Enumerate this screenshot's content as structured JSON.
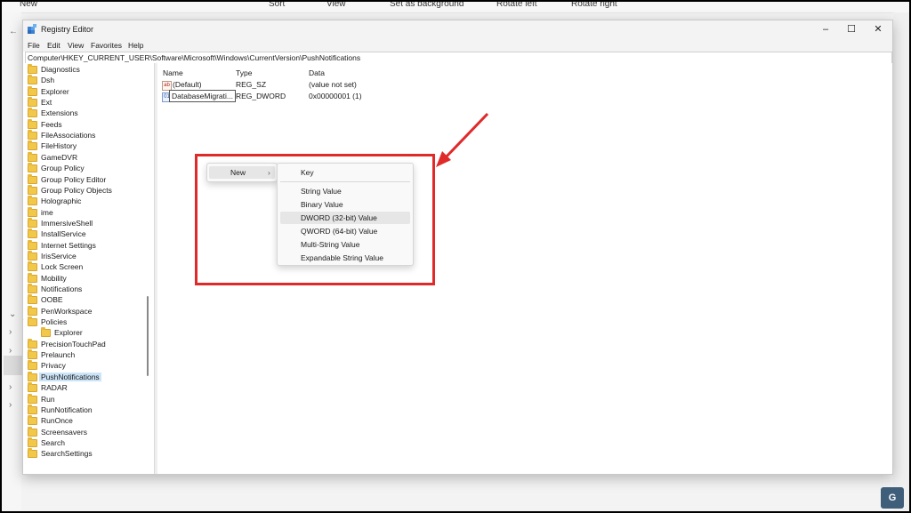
{
  "photos_toolbar": {
    "items": [
      "New",
      "Sort",
      "View",
      "Set as background",
      "Rotate left",
      "Rotate right"
    ]
  },
  "window": {
    "title": "Registry Editor",
    "menu": [
      "File",
      "Edit",
      "View",
      "Favorites",
      "Help"
    ],
    "address": "Computer\\HKEY_CURRENT_USER\\Software\\Microsoft\\Windows\\CurrentVersion\\PushNotifications"
  },
  "tree": {
    "items": [
      "Diagnostics",
      "Dsh",
      "Explorer",
      "Ext",
      "Extensions",
      "Feeds",
      "FileAssociations",
      "FileHistory",
      "GameDVR",
      "Group Policy",
      "Group Policy Editor",
      "Group Policy Objects",
      "Holographic",
      "ime",
      "ImmersiveShell",
      "InstallService",
      "Internet Settings",
      "IrisService",
      "Lock Screen",
      "Mobility",
      "Notifications",
      "OOBE",
      "PenWorkspace",
      "Policies",
      "Explorer",
      "PrecisionTouchPad",
      "Prelaunch",
      "Privacy",
      "PushNotifications",
      "RADAR",
      "Run",
      "RunNotification",
      "RunOnce",
      "Screensavers",
      "Search",
      "SearchSettings"
    ],
    "selected": "PushNotifications"
  },
  "values_list": {
    "headers": {
      "name": "Name",
      "type": "Type",
      "data": "Data"
    },
    "rows": [
      {
        "name": "(Default)",
        "type": "REG_SZ",
        "data": "(value not set)",
        "icon": "string-value-icon"
      },
      {
        "name": "DatabaseMigrati...",
        "type": "REG_DWORD",
        "data": "0x00000001 (1)",
        "icon": "binary-value-icon"
      }
    ]
  },
  "context_menu": {
    "new_label": "New",
    "submenu": {
      "key": "Key",
      "items": [
        "String Value",
        "Binary Value",
        "DWORD (32-bit) Value",
        "QWORD (64-bit) Value",
        "Multi-String Value",
        "Expandable String Value"
      ],
      "highlighted": "DWORD (32-bit) Value"
    }
  },
  "annotation": {
    "color": "#e02a2a"
  }
}
